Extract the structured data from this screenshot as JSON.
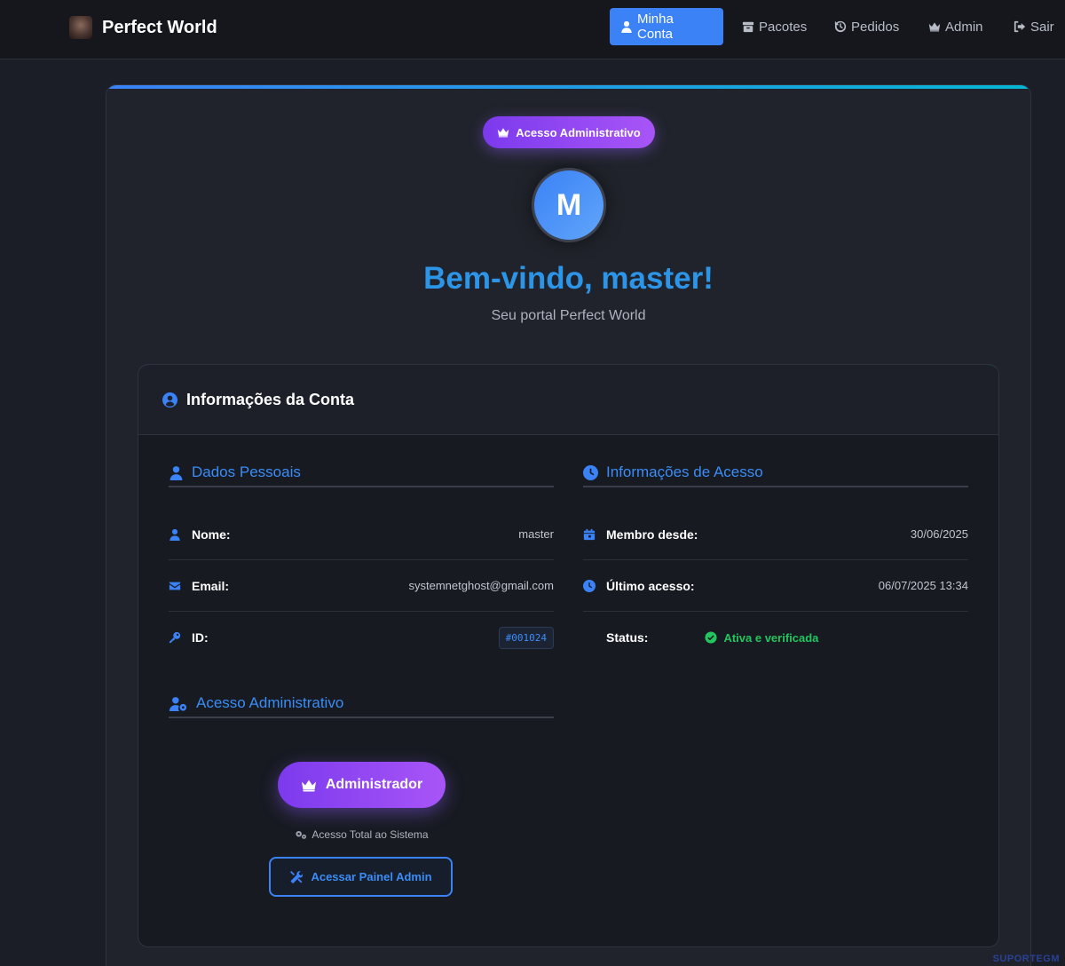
{
  "navbar": {
    "brand_name": "Perfect World",
    "logo_text": "PERFECT WORLD",
    "items": [
      {
        "label": "Minha Conta",
        "icon": "user-icon",
        "active": true
      },
      {
        "label": "Pacotes",
        "icon": "box-icon",
        "active": false
      },
      {
        "label": "Pedidos",
        "icon": "history-icon",
        "active": false
      },
      {
        "label": "Admin",
        "icon": "crown-icon",
        "active": false
      },
      {
        "label": "Sair",
        "icon": "logout-icon",
        "active": false
      }
    ]
  },
  "hero": {
    "badge_label": "Acesso Administrativo",
    "avatar_initial": "M",
    "welcome": "Bem-vindo, master!",
    "subtitle": "Seu portal Perfect World"
  },
  "account_card": {
    "title": "Informações da Conta",
    "personal": {
      "title": "Dados Pessoais",
      "rows": [
        {
          "label": "Nome:",
          "value": "master",
          "icon": "user-icon"
        },
        {
          "label": "Email:",
          "value": "systemnetghost@gmail.com",
          "icon": "envelope-icon"
        },
        {
          "label": "ID:",
          "value": "#001024",
          "icon": "key-icon"
        }
      ]
    },
    "access": {
      "title": "Informações de Acesso",
      "rows": [
        {
          "label": "Membro desde:",
          "value": "30/06/2025",
          "icon": "calendar-icon"
        },
        {
          "label": "Último acesso:",
          "value": "06/07/2025 13:34",
          "icon": "clock-icon"
        },
        {
          "label": "Status:",
          "value": "Ativa e verificada",
          "icon": "check-circle-icon"
        }
      ]
    },
    "admin": {
      "title": "Acesso Administrativo",
      "role_label": "Administrador",
      "note": "Acesso Total ao Sistema",
      "panel_button": "Acessar Painel Admin"
    }
  },
  "colors": {
    "accent": "#3b82f6",
    "admin_purple": "#8b5cf6",
    "success": "#22c55e",
    "welcome_text": "#2d95e8"
  },
  "watermark": "SUPORTEGM"
}
